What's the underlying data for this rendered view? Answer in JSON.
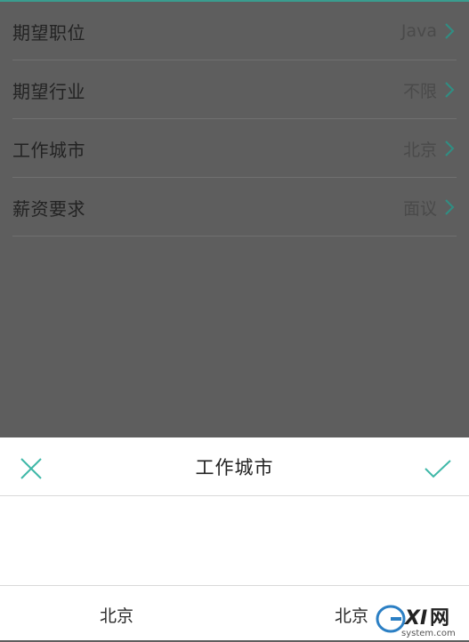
{
  "form": {
    "rows": [
      {
        "label": "期望职位",
        "value": "Java"
      },
      {
        "label": "期望行业",
        "value": "不限"
      },
      {
        "label": "工作城市",
        "value": "北京"
      },
      {
        "label": "薪资要求",
        "value": "面议"
      }
    ]
  },
  "sheet": {
    "title": "工作城市",
    "options": [
      "北京",
      "北京"
    ]
  },
  "watermark": {
    "brand": "GXI网",
    "domain": "system.com"
  },
  "colors": {
    "accent": "#3fb8a8",
    "overlay": "#5e5e5e"
  },
  "icons": {
    "close": "close-icon",
    "confirm": "check-icon",
    "row_arrow": "chevron-right-icon"
  }
}
